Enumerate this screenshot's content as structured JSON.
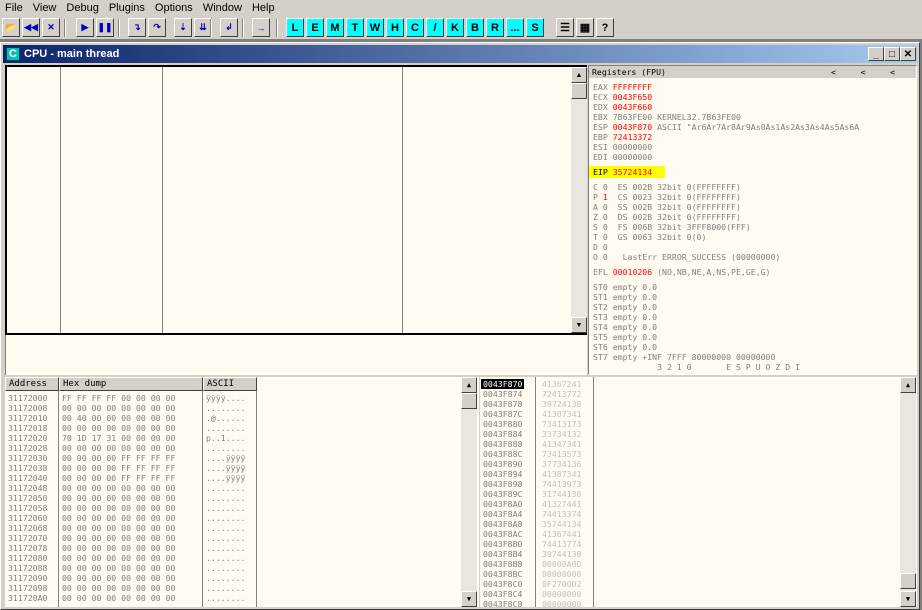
{
  "menu": [
    "File",
    "View",
    "Debug",
    "Plugins",
    "Options",
    "Window",
    "Help"
  ],
  "toolbar": {
    "icons": [
      "open-icon",
      "restart-icon",
      "close-program-icon",
      "run-icon",
      "pause-icon",
      "step-into-icon",
      "step-over-icon",
      "trace-into-icon",
      "trace-over-icon",
      "execute-till-return-icon",
      "goto-icon"
    ],
    "letters": [
      "L",
      "E",
      "M",
      "T",
      "W",
      "H",
      "C",
      "/",
      "K",
      "B",
      "R",
      "...",
      "S"
    ],
    "right_icons": [
      "list-icon",
      "grid-icon",
      "help-icon"
    ]
  },
  "window": {
    "title": "CPU - main thread",
    "icon_letter": "C"
  },
  "registers": {
    "header": "Registers (FPU)",
    "header_arrows": "<     <     <",
    "gp": [
      {
        "name": "EAX",
        "value": "FFFFFFFF",
        "extra": "",
        "changed": true
      },
      {
        "name": "ECX",
        "value": "0043F650",
        "extra": "",
        "changed": true
      },
      {
        "name": "EDX",
        "value": "0043F660",
        "extra": "",
        "changed": true
      },
      {
        "name": "EBX",
        "value": "7B63FE00",
        "extra": "KERNEL32.7B63FE00",
        "changed": false
      },
      {
        "name": "ESP",
        "value": "0043F870",
        "extra": "ASCII \"Ar6Ar7Ar8Ar9As0As1As2As3As4As5As6A",
        "changed": true
      },
      {
        "name": "EBP",
        "value": "72413372",
        "extra": "",
        "changed": true
      },
      {
        "name": "ESI",
        "value": "00000000",
        "extra": "",
        "changed": false
      },
      {
        "name": "EDI",
        "value": "00000000",
        "extra": "",
        "changed": false
      }
    ],
    "eip": {
      "name": "EIP",
      "value": "35724134"
    },
    "flags": [
      {
        "flag": "C",
        "bit": "0",
        "seg": "ES 002B 32bit 0(FFFFFFFF)",
        "changed": false
      },
      {
        "flag": "P",
        "bit": "1",
        "seg": "CS 0023 32bit 0(FFFFFFFF)",
        "changed": true
      },
      {
        "flag": "A",
        "bit": "0",
        "seg": "SS 002B 32bit 0(FFFFFFFF)",
        "changed": false
      },
      {
        "flag": "Z",
        "bit": "0",
        "seg": "DS 002B 32bit 0(FFFFFFFF)",
        "changed": false
      },
      {
        "flag": "S",
        "bit": "0",
        "seg": "FS 006B 32bit 3FFF8000(FFF)",
        "changed": false
      },
      {
        "flag": "T",
        "bit": "0",
        "seg": "GS 0063 32bit 0(0)",
        "changed": false
      },
      {
        "flag": "D",
        "bit": "0",
        "seg": "",
        "changed": false
      },
      {
        "flag": "O",
        "bit": "0",
        "seg": " LastErr ERROR_SUCCESS (00000000)",
        "changed": false
      }
    ],
    "efl": {
      "name": "EFL",
      "value": "00010206",
      "extra": "(NO,NB,NE,A,NS,PE,GE,G)"
    },
    "fpu": [
      "ST0 empty 0.0",
      "ST1 empty 0.0",
      "ST2 empty 0.0",
      "ST3 empty 0.0",
      "ST4 empty 0.0",
      "ST5 empty 0.0",
      "ST6 empty 0.0",
      "ST7 empty +INF 7FFF 80000000 00000000",
      "             3 2 1 0       E S P U O Z D I",
      "FST 0000  Cond 0 0 0 0  Err 0 0 0 0 0 0 0 0  (GT)"
    ]
  },
  "dump": {
    "headers": [
      "Address",
      "Hex dump",
      "ASCII"
    ],
    "rows": [
      [
        "31172000",
        "FF FF FF FF 00 00 00 00",
        "ÿÿÿÿ...."
      ],
      [
        "31172008",
        "00 00 00 00 00 00 00 00",
        "........"
      ],
      [
        "31172010",
        "00 40 00 00 00 00 00 00",
        ".@......"
      ],
      [
        "31172018",
        "00 00 00 00 00 00 00 00",
        "........"
      ],
      [
        "31172020",
        "70 1D 17 31 00 00 00 00",
        "p..1...."
      ],
      [
        "31172028",
        "00 00 00 00 00 00 00 00",
        "........"
      ],
      [
        "31172030",
        "00 00 00 00 FF FF FF FF",
        "....ÿÿÿÿ"
      ],
      [
        "31172038",
        "00 00 00 00 FF FF FF FF",
        "....ÿÿÿÿ"
      ],
      [
        "31172040",
        "00 00 00 00 FF FF FF FF",
        "....ÿÿÿÿ"
      ],
      [
        "31172048",
        "00 00 00 00 00 00 00 00",
        "........"
      ],
      [
        "31172050",
        "00 00 00 00 00 00 00 00",
        "........"
      ],
      [
        "31172058",
        "00 00 00 00 00 00 00 00",
        "........"
      ],
      [
        "31172060",
        "00 00 00 00 00 00 00 00",
        "........"
      ],
      [
        "31172068",
        "00 00 00 00 00 00 00 00",
        "........"
      ],
      [
        "31172070",
        "00 00 00 00 00 00 00 00",
        "........"
      ],
      [
        "31172078",
        "00 00 00 00 00 00 00 00",
        "........"
      ],
      [
        "31172080",
        "00 00 00 00 00 00 00 00",
        "........"
      ],
      [
        "31172088",
        "00 00 00 00 00 00 00 00",
        "........"
      ],
      [
        "31172090",
        "00 00 00 00 00 00 00 00",
        "........"
      ],
      [
        "31172098",
        "00 00 00 00 00 00 00 00",
        "........"
      ],
      [
        "311720A0",
        "00 00 00 00 00 00 00 00",
        "........"
      ]
    ]
  },
  "stack": {
    "rows": [
      [
        "0043F870",
        "41367241",
        true
      ],
      [
        "0043F874",
        "72413772",
        false
      ],
      [
        "0043F878",
        "39724138",
        false
      ],
      [
        "0043F87C",
        "41307341",
        false
      ],
      [
        "0043F880",
        "73413173",
        false
      ],
      [
        "0043F884",
        "33734132",
        false
      ],
      [
        "0043F888",
        "41347341",
        false
      ],
      [
        "0043F88C",
        "73413573",
        false
      ],
      [
        "0043F890",
        "37734136",
        false
      ],
      [
        "0043F894",
        "41387341",
        false
      ],
      [
        "0043F898",
        "74413973",
        false
      ],
      [
        "0043F89C",
        "31744130",
        false
      ],
      [
        "0043F8A0",
        "41327441",
        false
      ],
      [
        "0043F8A4",
        "74413374",
        false
      ],
      [
        "0043F8A8",
        "35744134",
        false
      ],
      [
        "0043F8AC",
        "41367441",
        false
      ],
      [
        "0043F8B0",
        "74413774",
        false
      ],
      [
        "0043F8B4",
        "39744138",
        false
      ],
      [
        "0043F8B8",
        "00000A0D",
        false
      ],
      [
        "0043F8BC",
        "00000000",
        false
      ],
      [
        "0043F8C0",
        "0F270002",
        false
      ],
      [
        "0043F8C4",
        "00000000",
        false
      ],
      [
        "0043F8C8",
        "00000000",
        false
      ]
    ]
  },
  "colors": {
    "pane_bg": "#fffbf0",
    "changed_reg": "#ff0000",
    "eip_highlight": "#ffff00",
    "letter_button": "#00ffff",
    "title_gradient_start": "#0a246a"
  }
}
